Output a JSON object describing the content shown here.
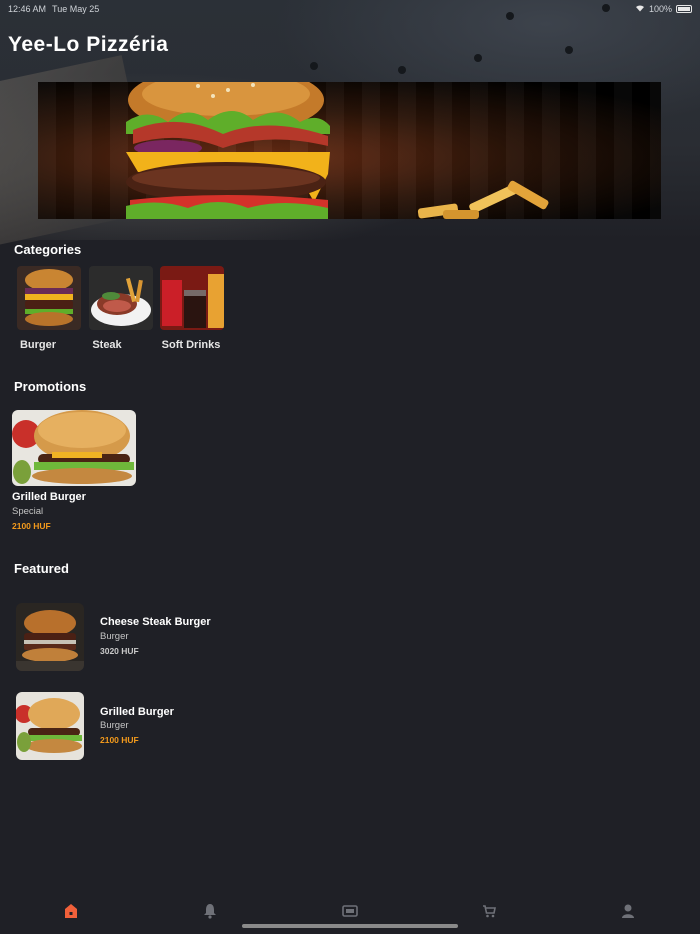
{
  "status": {
    "time": "12:46 AM",
    "date": "Tue May 25",
    "battery": "100%"
  },
  "app": {
    "title": "Yee-Lo Pizzéria"
  },
  "sections": {
    "categories": "Categories",
    "promotions": "Promotions",
    "featured": "Featured"
  },
  "categories": [
    {
      "label": "Burger"
    },
    {
      "label": "Steak"
    },
    {
      "label": "Soft Drinks"
    }
  ],
  "promotions": [
    {
      "name": "Grilled Burger",
      "tag": "Special",
      "price": "2100 HUF"
    }
  ],
  "featured": [
    {
      "name": "Cheese Steak Burger",
      "category": "Burger",
      "price": "3020 HUF"
    },
    {
      "name": "Grilled Burger",
      "category": "Burger",
      "price": "2100 HUF"
    }
  ],
  "tabs": [
    {
      "icon": "home-icon",
      "active": true
    },
    {
      "icon": "bell-icon",
      "active": false
    },
    {
      "icon": "ticket-icon",
      "active": false
    },
    {
      "icon": "cart-icon",
      "active": false
    },
    {
      "icon": "profile-icon",
      "active": false
    }
  ],
  "colors": {
    "background": "#1f2026",
    "accent": "#f39a1c",
    "active_tab": "#f0603a"
  }
}
